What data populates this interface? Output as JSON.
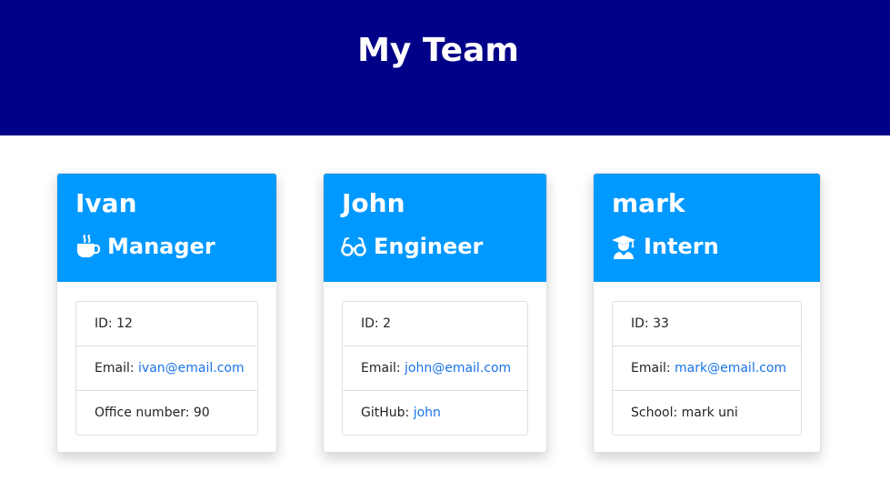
{
  "header": {
    "title": "My Team"
  },
  "team": [
    {
      "name": "Ivan",
      "role": "Manager",
      "role_icon": "coffee-icon",
      "id_label": "ID:",
      "id": "12",
      "email_label": "Email:",
      "email": "ivan@email.com",
      "extra_label": "Office number:",
      "extra_value": "90"
    },
    {
      "name": "John",
      "role": "Engineer",
      "role_icon": "glasses-icon",
      "id_label": "ID:",
      "id": "2",
      "email_label": "Email:",
      "email": "john@email.com",
      "extra_label": "GitHub:",
      "extra_value": "john"
    },
    {
      "name": "mark",
      "role": "Intern",
      "role_icon": "graduate-icon",
      "id_label": "ID:",
      "id": "33",
      "email_label": "Email:",
      "email": "mark@email.com",
      "extra_label": "School:",
      "extra_value": "mark uni"
    }
  ],
  "colors": {
    "header_bg": "#000088",
    "card_header_bg": "#0099ff",
    "link": "#1a73e8"
  }
}
